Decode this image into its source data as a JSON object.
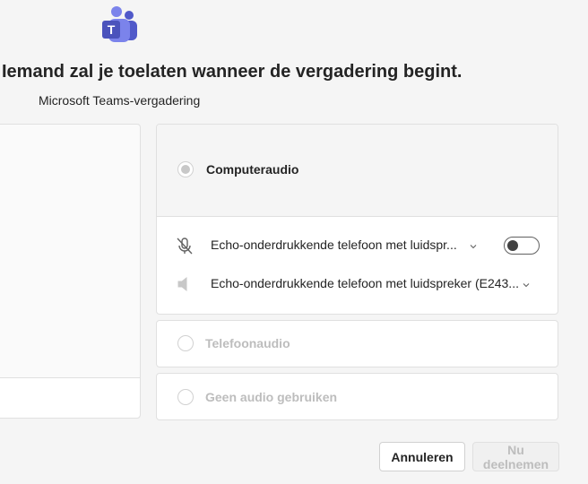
{
  "header": {
    "logo_icon": "teams-logo-icon",
    "logo_letter": "T",
    "title": "Iemand zal je toelaten wanneer de vergadering begint.",
    "subtitle": "Microsoft Teams-vergadering"
  },
  "audio_options": {
    "computer_audio": {
      "label": "Computeraudio",
      "selected": true,
      "microphone": {
        "icon": "microphone-off-icon",
        "device": "Echo-onderdrukkende telefoon met luidspr...",
        "toggle_on": false
      },
      "speaker": {
        "icon": "speaker-icon",
        "device": "Echo-onderdrukkende telefoon met luidspreker (E243..."
      }
    },
    "phone_audio": {
      "label": "Telefoonaudio",
      "selected": false
    },
    "no_audio": {
      "label": "Geen audio gebruiken",
      "selected": false
    }
  },
  "actions": {
    "cancel_label": "Annuleren",
    "join_label": "Nu deelnemen",
    "join_enabled": false
  },
  "colors": {
    "background": "#f5f5f5",
    "card": "#ffffff",
    "teams_purple": "#5b5fc7",
    "disabled_text": "#bdbdbd"
  }
}
